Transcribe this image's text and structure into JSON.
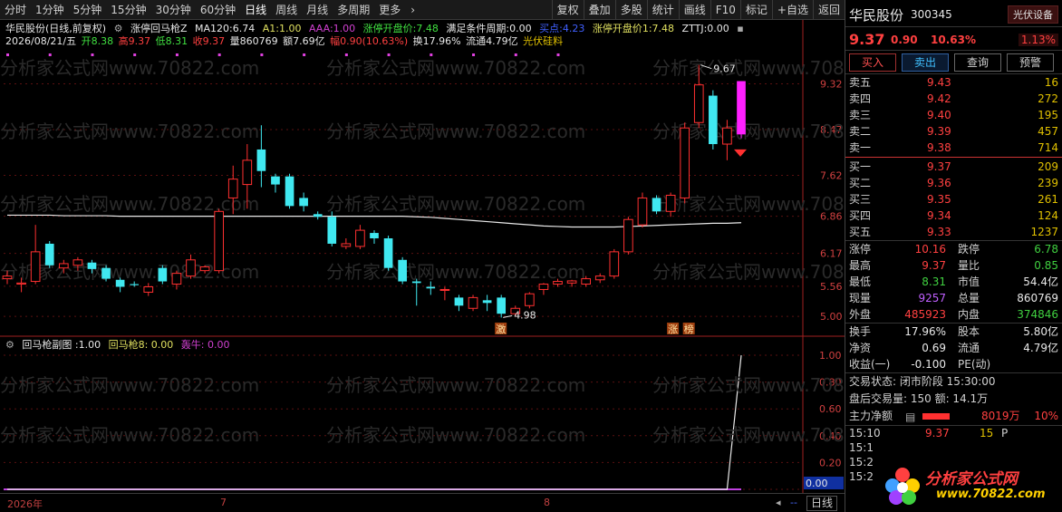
{
  "toolbar": {
    "periods": [
      "分时",
      "1分钟",
      "5分钟",
      "15分钟",
      "30分钟",
      "60分钟",
      "日线",
      "周线",
      "月线",
      "多周期",
      "更多"
    ],
    "active_period": "日线",
    "right_buttons": [
      "复权",
      "叠加",
      "多股",
      "统计",
      "画线",
      "F10",
      "标记",
      "+自选",
      "返回"
    ]
  },
  "main": {
    "title": "华民股份(日线,前复权)",
    "indicators": {
      "name": "涨停回马枪Z",
      "ma120_label": "MA120:",
      "ma120": "6.74",
      "a1_label": "A1:",
      "a1": "1.00",
      "aaa_label": "AAA:",
      "aaa": "1.00",
      "limitopen_label": "涨停开盘价:",
      "limitopen": "7.48",
      "cond_label": "满足条件周期:",
      "cond": "0.00",
      "buy_label": "买点:",
      "buy": "4.23",
      "limitopen1_label": "涨停开盘价1:",
      "limitopen1": "7.48",
      "zttj_label": "ZTTJ:",
      "zttj": "0.00"
    },
    "ohlc": {
      "date": "2026/08/21/五",
      "open_label": "开",
      "open": "8.38",
      "high_label": "高",
      "high": "9.37",
      "low_label": "低",
      "low": "8.31",
      "close_label": "收",
      "close": "9.37",
      "vol_label": "量",
      "vol": "860769",
      "amt_label": "额",
      "amt": "7.69亿",
      "amp_label": "幅",
      "amp": "0.90(10.63%)",
      "turn_label": "换",
      "turn": "17.96%",
      "float_label": "流通",
      "float": "4.79亿",
      "concept": "光伏硅料"
    },
    "max_label": "9.67",
    "min_label": "4.98",
    "signal_low": "激",
    "signal_high1": "涨",
    "signal_high2": "榜",
    "y_ticks": [
      "9.32",
      "8.47",
      "7.62",
      "6.86",
      "6.17",
      "5.56",
      "5.00"
    ],
    "watermark": "分析家公式网www.70822.com"
  },
  "sub": {
    "name": "回马枪副图",
    "v1": ":1.00",
    "v2_label": "回马枪8:",
    "v2": "0.00",
    "v3_label": "轰牛:",
    "v3": "0.00",
    "y_ticks": [
      "1.00",
      "0.80",
      "0.60",
      "0.40",
      "0.20",
      "0.00"
    ],
    "current": "0.00"
  },
  "bottom": {
    "dates": [
      "2026年",
      "7",
      "8"
    ],
    "period_button": "日线"
  },
  "panel": {
    "name": "华民股份",
    "code": "300345",
    "badge": "光伏设备",
    "price": "9.37",
    "change": "0.90",
    "change_pct": "10.63%",
    "badge_pct": "1.13%",
    "buttons": {
      "buy": "买入",
      "sell": "卖出",
      "query": "查询",
      "alert": "预警"
    },
    "asks": [
      {
        "label": "卖五",
        "price": "9.43",
        "vol": "16"
      },
      {
        "label": "卖四",
        "price": "9.42",
        "vol": "272"
      },
      {
        "label": "卖三",
        "price": "9.40",
        "vol": "195"
      },
      {
        "label": "卖二",
        "price": "9.39",
        "vol": "457"
      },
      {
        "label": "卖一",
        "price": "9.38",
        "vol": "714"
      }
    ],
    "bids": [
      {
        "label": "买一",
        "price": "9.37",
        "vol": "209"
      },
      {
        "label": "买二",
        "price": "9.36",
        "vol": "239"
      },
      {
        "label": "买三",
        "price": "9.35",
        "vol": "261"
      },
      {
        "label": "买四",
        "price": "9.34",
        "vol": "124"
      },
      {
        "label": "买五",
        "price": "9.33",
        "vol": "1237"
      }
    ],
    "stats1": [
      {
        "k1": "涨停",
        "v1": "10.16",
        "c1": "red",
        "k2": "跌停",
        "v2": "6.78",
        "c2": "green"
      },
      {
        "k1": "最高",
        "v1": "9.37",
        "c1": "red",
        "k2": "量比",
        "v2": "0.85",
        "c2": "green"
      },
      {
        "k1": "最低",
        "v1": "8.31",
        "c1": "green",
        "k2": "市值",
        "v2": "54.4亿",
        "c2": "white"
      },
      {
        "k1": "现量",
        "v1": "9257",
        "c1": "purple",
        "k2": "总量",
        "v2": "860769",
        "c2": "white"
      },
      {
        "k1": "外盘",
        "v1": "485923",
        "c1": "red",
        "k2": "内盘",
        "v2": "374846",
        "c2": "green"
      }
    ],
    "stats2": [
      {
        "k1": "换手",
        "v1": "17.96%",
        "c1": "white",
        "k2": "股本",
        "v2": "5.80亿",
        "c2": "white"
      },
      {
        "k1": "净资",
        "v1": "0.69",
        "c1": "white",
        "k2": "流通",
        "v2": "4.79亿",
        "c2": "white"
      },
      {
        "k1": "收益(一)",
        "v1": "-0.100",
        "c1": "white",
        "k2": "PE(动)",
        "v2": "",
        "c2": "white"
      }
    ],
    "status": "交易状态: 闭市阶段 15:30:00",
    "after_hours": "盘后交易量: 150  额: 14.1万",
    "mainflow_label": "主力净额",
    "mainflow_value": "8019万",
    "mainflow_pct": "10%",
    "ticks": [
      {
        "t": "15:10",
        "p": "9.37",
        "v": "15",
        "f": "P"
      },
      {
        "t": "15:1",
        "p": "",
        "v": "",
        "f": ""
      },
      {
        "t": "15:2",
        "p": "",
        "v": "",
        "f": ""
      },
      {
        "t": "15:2",
        "p": "",
        "v": "",
        "f": ""
      }
    ],
    "logo_text1": "分析家公式网",
    "logo_text2": "www.70822.com"
  },
  "chart_data": {
    "type": "candlestick",
    "ylim": [
      4.7,
      9.9
    ],
    "y_ticks": [
      9.32,
      8.47,
      7.62,
      6.86,
      6.17,
      5.56,
      5.0
    ],
    "candles": [
      {
        "o": 5.7,
        "h": 5.85,
        "l": 5.6,
        "c": 5.75
      },
      {
        "o": 5.6,
        "h": 5.72,
        "l": 5.45,
        "c": 5.62
      },
      {
        "o": 5.65,
        "h": 6.7,
        "l": 5.6,
        "c": 6.2
      },
      {
        "o": 6.35,
        "h": 6.4,
        "l": 5.9,
        "c": 5.95
      },
      {
        "o": 5.9,
        "h": 6.05,
        "l": 5.8,
        "c": 5.98
      },
      {
        "o": 5.95,
        "h": 6.1,
        "l": 5.85,
        "c": 6.05
      },
      {
        "o": 6.0,
        "h": 6.05,
        "l": 5.8,
        "c": 5.88
      },
      {
        "o": 5.9,
        "h": 5.95,
        "l": 5.65,
        "c": 5.7
      },
      {
        "o": 5.68,
        "h": 5.72,
        "l": 5.45,
        "c": 5.55
      },
      {
        "o": 5.6,
        "h": 5.65,
        "l": 5.55,
        "c": 5.58
      },
      {
        "o": 5.45,
        "h": 5.62,
        "l": 5.38,
        "c": 5.55
      },
      {
        "o": 5.9,
        "h": 5.95,
        "l": 5.6,
        "c": 5.65
      },
      {
        "o": 5.6,
        "h": 5.85,
        "l": 5.5,
        "c": 5.8
      },
      {
        "o": 5.75,
        "h": 6.15,
        "l": 5.7,
        "c": 6.05
      },
      {
        "o": 5.85,
        "h": 5.95,
        "l": 5.8,
        "c": 5.92
      },
      {
        "o": 5.85,
        "h": 7.0,
        "l": 5.8,
        "c": 6.95
      },
      {
        "o": 7.2,
        "h": 7.8,
        "l": 6.9,
        "c": 7.55
      },
      {
        "o": 7.45,
        "h": 8.2,
        "l": 7.0,
        "c": 7.9
      },
      {
        "o": 8.1,
        "h": 8.55,
        "l": 7.4,
        "c": 7.7
      },
      {
        "o": 7.6,
        "h": 7.65,
        "l": 7.3,
        "c": 7.45
      },
      {
        "o": 7.6,
        "h": 7.65,
        "l": 7.0,
        "c": 7.05
      },
      {
        "o": 7.2,
        "h": 7.3,
        "l": 6.95,
        "c": 7.05
      },
      {
        "o": 6.9,
        "h": 6.95,
        "l": 6.8,
        "c": 6.85
      },
      {
        "o": 6.85,
        "h": 6.95,
        "l": 6.3,
        "c": 6.35
      },
      {
        "o": 6.3,
        "h": 6.45,
        "l": 6.25,
        "c": 6.35
      },
      {
        "o": 6.3,
        "h": 6.7,
        "l": 6.25,
        "c": 6.6
      },
      {
        "o": 6.55,
        "h": 6.6,
        "l": 6.35,
        "c": 6.45
      },
      {
        "o": 6.45,
        "h": 6.5,
        "l": 5.85,
        "c": 5.9
      },
      {
        "o": 6.05,
        "h": 6.1,
        "l": 5.6,
        "c": 5.65
      },
      {
        "o": 5.65,
        "h": 5.7,
        "l": 5.2,
        "c": 5.62
      },
      {
        "o": 5.55,
        "h": 5.65,
        "l": 5.4,
        "c": 5.52
      },
      {
        "o": 5.5,
        "h": 5.55,
        "l": 5.3,
        "c": 5.5
      },
      {
        "o": 5.35,
        "h": 5.4,
        "l": 5.1,
        "c": 5.2
      },
      {
        "o": 5.15,
        "h": 5.4,
        "l": 5.1,
        "c": 5.35
      },
      {
        "o": 5.3,
        "h": 5.4,
        "l": 5.1,
        "c": 5.25
      },
      {
        "o": 5.35,
        "h": 5.4,
        "l": 4.98,
        "c": 5.05
      },
      {
        "o": 5.05,
        "h": 5.2,
        "l": 5.0,
        "c": 5.15
      },
      {
        "o": 5.2,
        "h": 5.45,
        "l": 5.15,
        "c": 5.42
      },
      {
        "o": 5.5,
        "h": 5.62,
        "l": 5.4,
        "c": 5.6
      },
      {
        "o": 5.6,
        "h": 5.7,
        "l": 5.55,
        "c": 5.65
      },
      {
        "o": 5.62,
        "h": 5.68,
        "l": 5.55,
        "c": 5.66
      },
      {
        "o": 5.6,
        "h": 5.75,
        "l": 5.55,
        "c": 5.7
      },
      {
        "o": 5.68,
        "h": 5.8,
        "l": 5.62,
        "c": 5.75
      },
      {
        "o": 5.75,
        "h": 6.25,
        "l": 5.7,
        "c": 6.2
      },
      {
        "o": 6.2,
        "h": 6.85,
        "l": 6.15,
        "c": 6.8
      },
      {
        "o": 6.7,
        "h": 7.3,
        "l": 6.65,
        "c": 7.2
      },
      {
        "o": 7.2,
        "h": 7.25,
        "l": 6.9,
        "c": 6.95
      },
      {
        "o": 6.95,
        "h": 7.3,
        "l": 6.85,
        "c": 7.25
      },
      {
        "o": 7.2,
        "h": 8.6,
        "l": 7.1,
        "c": 8.5
      },
      {
        "o": 8.6,
        "h": 9.67,
        "l": 8.5,
        "c": 9.3
      },
      {
        "o": 9.1,
        "h": 9.2,
        "l": 8.1,
        "c": 8.2
      },
      {
        "o": 8.2,
        "h": 8.65,
        "l": 7.9,
        "c": 8.5
      },
      {
        "o": 8.38,
        "h": 9.37,
        "l": 8.31,
        "c": 9.37
      }
    ],
    "ma120": [
      6.88,
      6.88,
      6.88,
      6.88,
      6.87,
      6.87,
      6.87,
      6.87,
      6.86,
      6.86,
      6.86,
      6.86,
      6.86,
      6.86,
      6.86,
      6.86,
      6.86,
      6.86,
      6.86,
      6.86,
      6.86,
      6.86,
      6.86,
      6.86,
      6.86,
      6.86,
      6.86,
      6.86,
      6.86,
      6.85,
      6.84,
      6.82,
      6.8,
      6.78,
      6.76,
      6.74,
      6.72,
      6.7,
      6.68,
      6.67,
      6.66,
      6.66,
      6.66,
      6.66,
      6.67,
      6.68,
      6.69,
      6.7,
      6.71,
      6.72,
      6.73,
      6.73,
      6.74
    ],
    "sub_series": {
      "name": "回马枪副图",
      "ylim": [
        0,
        1.0
      ],
      "values": [
        0,
        0,
        0,
        0,
        0,
        0,
        0,
        0,
        0,
        0,
        0,
        0,
        0,
        0,
        0,
        0,
        0,
        0,
        0,
        0,
        0,
        0,
        0,
        0,
        0,
        0,
        0,
        0,
        0,
        0,
        0,
        0,
        0,
        0,
        0,
        0,
        0,
        0,
        0,
        0,
        0,
        0,
        0,
        0,
        0,
        0,
        0,
        0,
        0,
        0,
        0,
        0,
        1.0
      ]
    }
  }
}
